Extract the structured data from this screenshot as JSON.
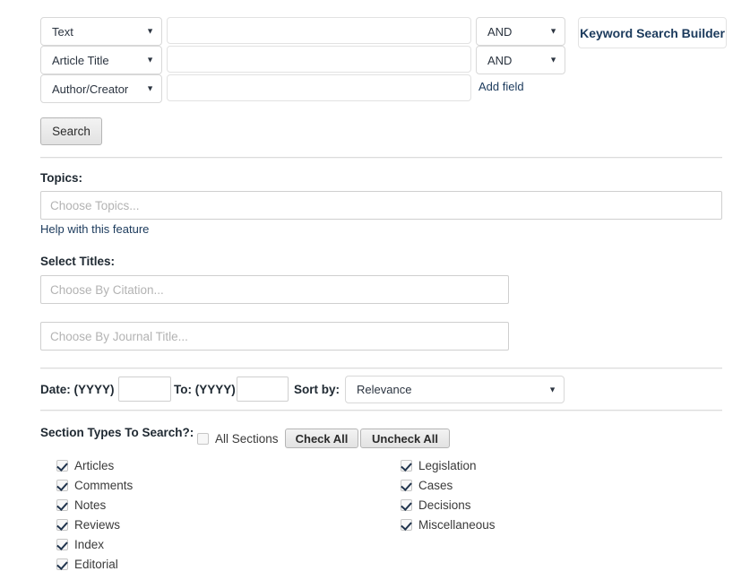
{
  "search_rows": [
    {
      "field_label": "Text",
      "value": "",
      "operator": "AND"
    },
    {
      "field_label": "Article Title",
      "value": "",
      "operator": "AND"
    },
    {
      "field_label": "Author/Creator",
      "value": "",
      "operator": null
    }
  ],
  "buttons": {
    "keyword_search_builder": "Keyword Search Builder",
    "add_field": "Add field",
    "search": "Search",
    "check_all": "Check All",
    "uncheck_all": "Uncheck All"
  },
  "topics": {
    "label": "Topics:",
    "placeholder": "Choose Topics...",
    "value": "",
    "help_link": "Help with this feature"
  },
  "select_titles": {
    "label": "Select Titles:",
    "citation_placeholder": "Choose By Citation...",
    "citation_value": "",
    "journal_placeholder": "Choose By Journal Title...",
    "journal_value": ""
  },
  "date_row": {
    "from_label": "Date: (YYYY)",
    "from_value": "",
    "to_label": "To: (YYYY)",
    "to_value": "",
    "sort_label": "Sort by:",
    "sort_value": "Relevance"
  },
  "sections": {
    "label": "Section Types To Search?:",
    "all_sections_label": "All Sections",
    "all_sections_checked": false,
    "left_column": [
      {
        "label": "Articles",
        "checked": true
      },
      {
        "label": "Comments",
        "checked": true
      },
      {
        "label": "Notes",
        "checked": true
      },
      {
        "label": "Reviews",
        "checked": true
      },
      {
        "label": "Index",
        "checked": true
      },
      {
        "label": "Editorial",
        "checked": true
      }
    ],
    "right_column": [
      {
        "label": "Legislation",
        "checked": true
      },
      {
        "label": "Cases",
        "checked": true
      },
      {
        "label": "Decisions",
        "checked": true
      },
      {
        "label": "Miscellaneous",
        "checked": true
      }
    ]
  },
  "icons": {
    "dropdown_caret": "▼"
  },
  "colors": {
    "link": "#1b3a5c",
    "accent": "#20344d",
    "placeholder": "#b3b3b3",
    "rule": "#dcdcdc"
  }
}
